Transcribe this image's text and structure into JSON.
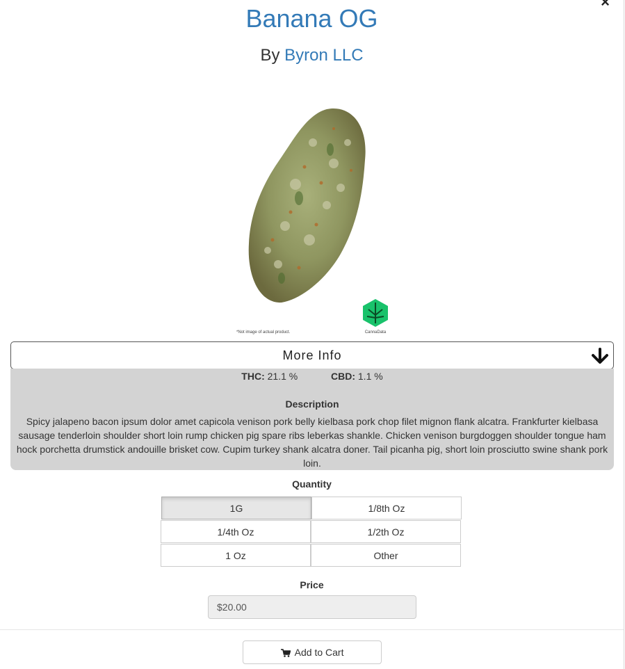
{
  "modal": {
    "close_glyph": "×",
    "title": "Banana OG",
    "by_prefix": "By",
    "brand": "Byron LLC"
  },
  "image": {
    "disclaimer": "*Not image of actual product.",
    "logo_text": "CannaData"
  },
  "more_info": {
    "label": "More Info",
    "icon": "arrow-down-icon"
  },
  "info": {
    "thc_label": "THC:",
    "thc_value": "21.1 %",
    "cbd_label": "CBD:",
    "cbd_value": "1.1 %",
    "description_title": "Description",
    "description": "Spicy jalapeno bacon ipsum dolor amet capicola venison pork belly kielbasa pork chop filet mignon flank alcatra. Frankfurter kielbasa sausage tenderloin shoulder short loin rump chicken pig spare ribs leberkas shankle. Chicken venison burgdoggen shoulder tongue ham hock porchetta drumstick andouille brisket cow. Cupim turkey shank alcatra doner. Tail picanha pig, short loin prosciutto swine shank pork loin."
  },
  "quantity": {
    "label": "Quantity",
    "options": [
      "1G",
      "1/8th Oz",
      "1/4th Oz",
      "1/2th Oz",
      "1 Oz",
      "Other"
    ],
    "selected": "1G"
  },
  "price": {
    "label": "Price",
    "value": "$20.00"
  },
  "cart": {
    "label": "Add to Cart",
    "icon": "cart-icon"
  },
  "colors": {
    "link": "#337ab7",
    "panel": "#d3d3d3",
    "logo_green": "#19c26b"
  }
}
